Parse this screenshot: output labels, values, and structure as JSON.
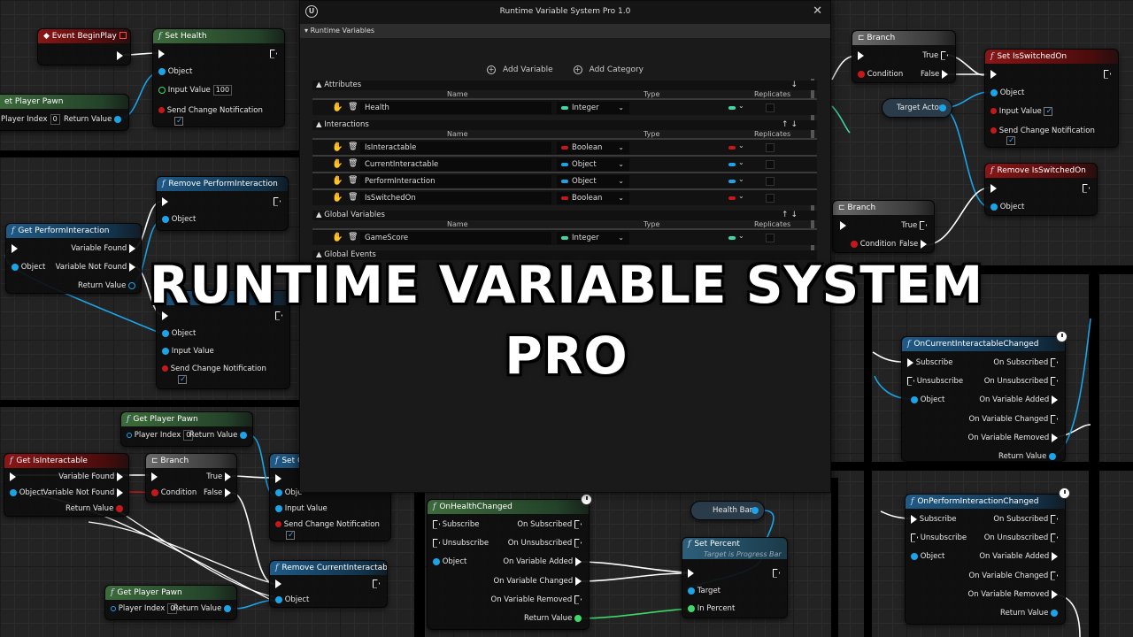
{
  "dialog": {
    "title": "Runtime Variable System Pro 1.0",
    "section": "Runtime Variables",
    "add_variable": "Add Variable",
    "add_category": "Add Category",
    "columns": {
      "name": "Name",
      "type": "Type",
      "replicates": "Replicates"
    },
    "categories": [
      {
        "label": "Attributes",
        "rows": [
          {
            "name": "Health",
            "type": "Integer",
            "color": "#3fd8a0"
          }
        ]
      },
      {
        "label": "Interactions",
        "rows": [
          {
            "name": "IsInteractable",
            "type": "Boolean",
            "color": "#c5181a"
          },
          {
            "name": "CurrentInteractable",
            "type": "Object",
            "color": "#1ba4e8"
          },
          {
            "name": "PerformInteraction",
            "type": "Object",
            "color": "#1ba4e8"
          },
          {
            "name": "IsSwitchedOn",
            "type": "Boolean",
            "color": "#c5181a"
          }
        ]
      },
      {
        "label": "Global Variables",
        "rows": [
          {
            "name": "GameScore",
            "type": "Integer",
            "color": "#3fd8a0"
          }
        ]
      },
      {
        "label": "Global Events",
        "rows": []
      }
    ]
  },
  "headline": {
    "line1": "RUNTIME VARIABLE SYSTEM",
    "line2": "PRO"
  },
  "nodes": {
    "event_begin_play": "Event BeginPlay",
    "set_health": {
      "title": "Set Health",
      "object": "Object",
      "input_value": "Input Value",
      "input_num": "100",
      "notify": "Send Change Notification"
    },
    "get_player_pawn_1": {
      "title": "et Player Pawn",
      "player_index": "Player Index",
      "idx": "0",
      "return": "Return Value"
    },
    "remove_perform": {
      "title": "Remove PerformInteraction",
      "object": "Object"
    },
    "get_perform": {
      "title": "Get PerformInteraction",
      "found": "Variable Found",
      "not_found": "Variable Not Found",
      "object": "Object",
      "return": "Return Value"
    },
    "set_perform": {
      "object": "Object",
      "input_value": "Input Value",
      "notify": "Send Change Notification"
    },
    "get_player_pawn_2": {
      "title": "Get Player Pawn",
      "player_index": "Player Index",
      "idx": "0",
      "return": "Return Value"
    },
    "get_isinteractable": {
      "title": "Get IsInteractable",
      "found": "Variable Found",
      "object": "Object",
      "not_found": "Variable Not Found",
      "return": "Return Value"
    },
    "branch_1": {
      "title": "Branch",
      "condition": "Condition",
      "true": "True",
      "false": "False"
    },
    "set_c": {
      "title": "Set C",
      "object": "Obje",
      "input_value": "Input Value",
      "notify": "Send Change Notification"
    },
    "remove_current": {
      "title": "Remove CurrentInteractable",
      "object": "Object"
    },
    "get_player_pawn_3": {
      "title": "Get Player Pawn",
      "player_index": "Player Index",
      "idx": "0",
      "return": "Return Value"
    },
    "on_health_changed": {
      "title": "OnHealthChanged",
      "subscribe": "Subscribe",
      "on_subscribed": "On Subscribed",
      "unsubscribe": "Unsubscribe",
      "on_unsubscribed": "On Unsubscribed",
      "object": "Object",
      "added": "On Variable Added",
      "changed": "On Variable Changed",
      "removed": "On Variable Removed",
      "return": "Return Value"
    },
    "health_bar": "Health Bar",
    "set_percent": {
      "title": "Set Percent",
      "subtitle": "Target is Progress Bar",
      "target": "Target",
      "in_percent": "In Percent"
    },
    "branch_2": {
      "title": "Branch",
      "condition": "Condition",
      "true": "True",
      "false": "False"
    },
    "target_actor": "Target Actor",
    "set_isswitchedon": {
      "title": "Set IsSwitchedOn",
      "object": "Object",
      "input_value": "Input Value",
      "notify": "Send Change Notification"
    },
    "remove_isswitchedon": {
      "title": "Remove IsSwitchedOn",
      "object": "Object"
    },
    "branch_3": {
      "title": "Branch",
      "condition": "Condition",
      "true": "True",
      "false": "False"
    },
    "on_current_changed": {
      "title": "OnCurrentInteractableChanged",
      "subscribe": "Subscribe",
      "on_subscribed": "On Subscribed",
      "unsubscribe": "Unsubscribe",
      "on_unsubscribed": "On Unsubscribed",
      "object": "Object",
      "added": "On Variable Added",
      "changed": "On Variable Changed",
      "removed": "On Variable Removed",
      "return": "Return Value"
    },
    "on_perform_changed": {
      "title": "OnPerformInteractionChanged",
      "subscribe": "Subscribe",
      "on_subscribed": "On Subscribed",
      "unsubscribe": "Unsubscribe",
      "on_unsubscribed": "On Unsubscribed",
      "object": "Object",
      "added": "On Variable Added",
      "changed": "On Variable Changed",
      "removed": "On Variable Removed",
      "return": "Return Value"
    }
  }
}
